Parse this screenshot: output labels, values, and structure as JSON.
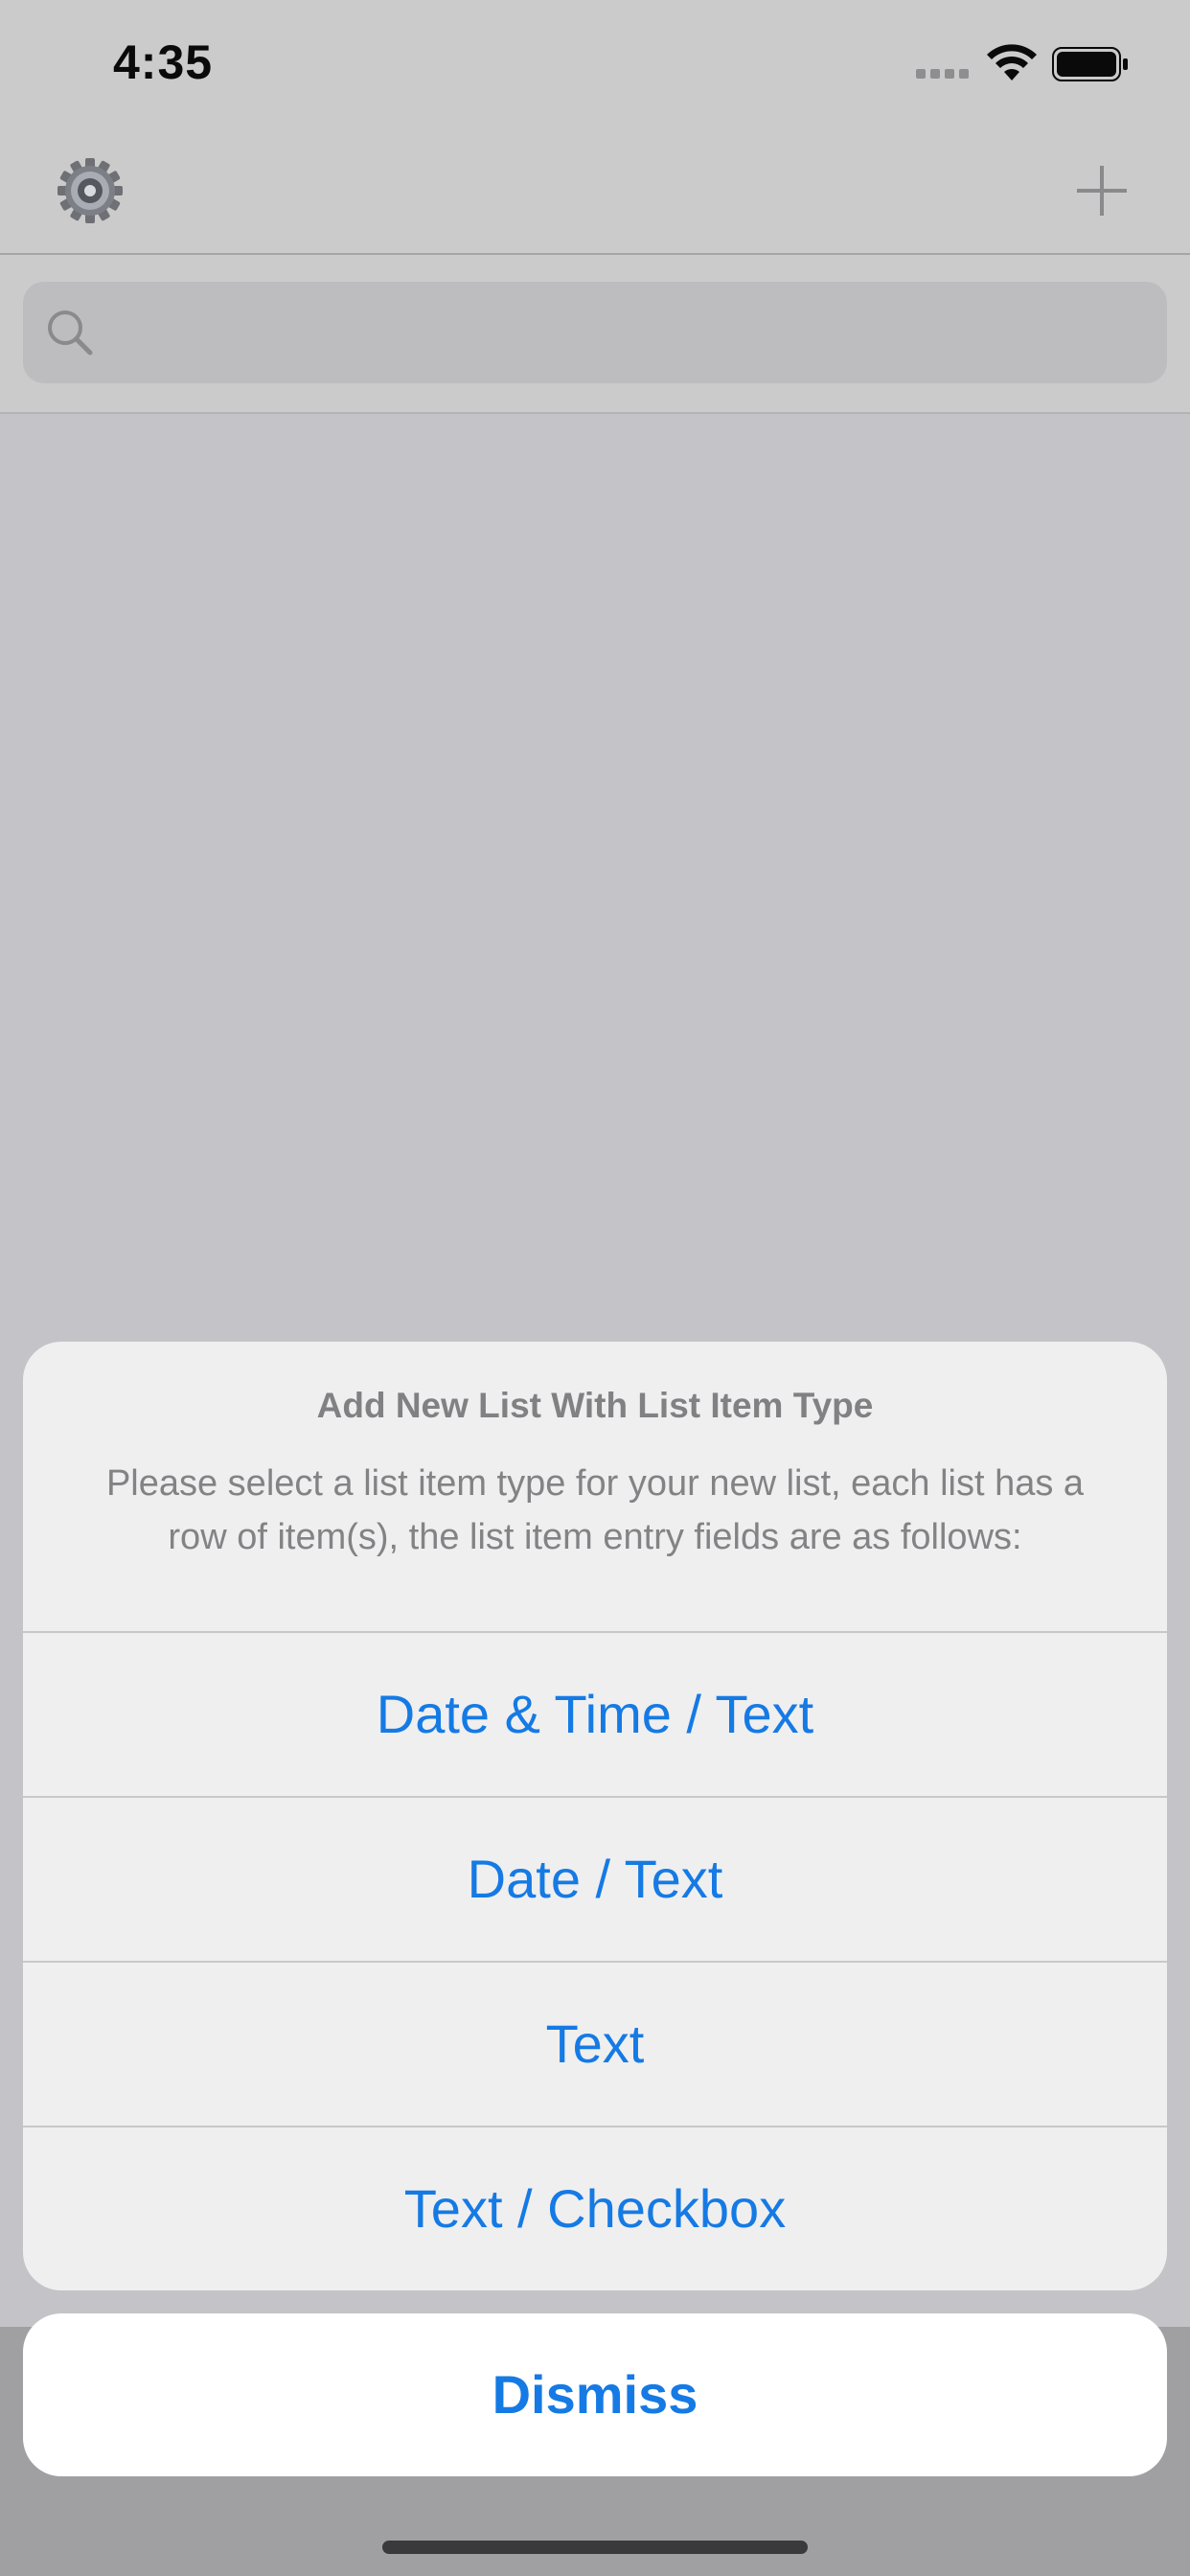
{
  "status_bar": {
    "time": "4:35"
  },
  "nav_bar": {
    "settings_icon": "gear-icon",
    "add_icon": "plus-icon"
  },
  "search": {
    "placeholder": "",
    "icon": "search-icon"
  },
  "action_sheet": {
    "title": "Add New List With List Item Type",
    "message": "Please select a list item type for your new list, each list has a row of item(s), the list item entry fields are as follows:",
    "options": [
      {
        "label": "Date & Time / Text"
      },
      {
        "label": "Date / Text"
      },
      {
        "label": "Text"
      },
      {
        "label": "Text / Checkbox"
      }
    ],
    "dismiss_label": "Dismiss"
  },
  "colors": {
    "accent": "#157ae4",
    "background": "#c4c4c8",
    "sheet": "#efeff0"
  }
}
